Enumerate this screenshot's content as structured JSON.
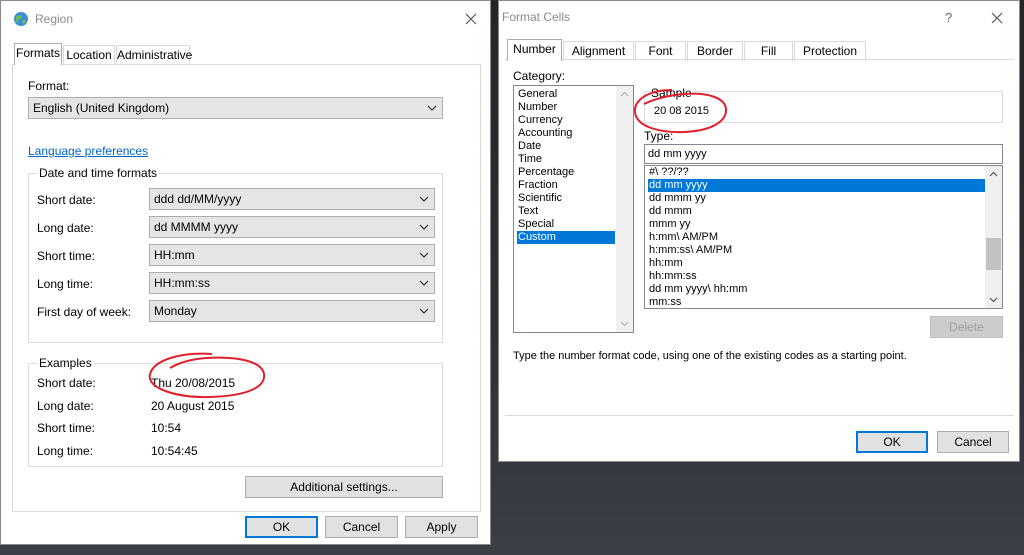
{
  "region": {
    "title": "Region",
    "tabs": [
      "Formats",
      "Location",
      "Administrative"
    ],
    "format_label": "Format:",
    "format_value": "English (United Kingdom)",
    "language_link": "Language preferences",
    "datetime_group": "Date and time formats",
    "fields": [
      {
        "label": "Short date:",
        "value": "ddd dd/MM/yyyy"
      },
      {
        "label": "Long date:",
        "value": "dd MMMM yyyy"
      },
      {
        "label": "Short time:",
        "value": "HH:mm"
      },
      {
        "label": "Long time:",
        "value": "HH:mm:ss"
      },
      {
        "label": "First day of week:",
        "value": "Monday"
      }
    ],
    "examples_group": "Examples",
    "examples": [
      {
        "label": "Short date:",
        "value": "Thu 20/08/2015"
      },
      {
        "label": "Long date:",
        "value": "20 August 2015"
      },
      {
        "label": "Short time:",
        "value": "10:54"
      },
      {
        "label": "Long time:",
        "value": "10:54:45"
      }
    ],
    "additional_settings": "Additional settings...",
    "ok": "OK",
    "cancel": "Cancel",
    "apply": "Apply"
  },
  "format_cells": {
    "title": "Format Cells",
    "help": "?",
    "tabs": [
      "Number",
      "Alignment",
      "Font",
      "Border",
      "Fill",
      "Protection"
    ],
    "category_label": "Category:",
    "categories": [
      "General",
      "Number",
      "Currency",
      "Accounting",
      "Date",
      "Time",
      "Percentage",
      "Fraction",
      "Scientific",
      "Text",
      "Special",
      "Custom"
    ],
    "selected_category": "Custom",
    "sample_label": "Sample",
    "sample_value": "20 08 2015",
    "type_label": "Type:",
    "type_value": "dd mm yyyy",
    "formats": [
      "#\\ ??/??",
      "dd mm yyyy",
      "dd mmm yy",
      "dd mmm",
      "mmm yy",
      "h:mm\\ AM/PM",
      "h:mm:ss\\ AM/PM",
      "hh:mm",
      "hh:mm:ss",
      "dd mm yyyy\\ hh:mm",
      "mm:ss"
    ],
    "selected_format": "dd mm yyyy",
    "delete": "Delete",
    "hint": "Type the number format code, using one of the existing codes as a starting point.",
    "ok": "OK",
    "cancel": "Cancel"
  },
  "colors": {
    "accent": "#0078d7",
    "link": "#0066cc",
    "annotation": "#e0202a"
  }
}
